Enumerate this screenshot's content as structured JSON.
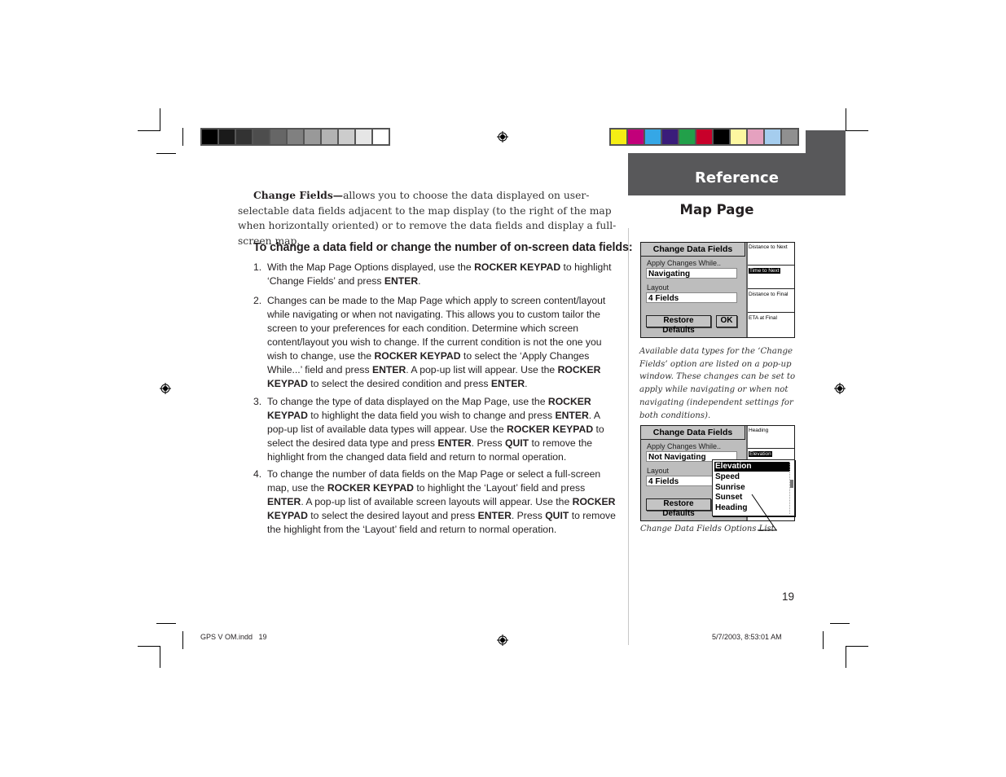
{
  "header": {
    "section_tab": "Reference",
    "page_title": "Map Page"
  },
  "print_marks": {
    "gray_bar_colors": [
      "#000000",
      "#1a1a1a",
      "#333333",
      "#4d4d4d",
      "#666666",
      "#808080",
      "#999999",
      "#b3b3b3",
      "#cccccc",
      "#e6e6e6",
      "#ffffff"
    ],
    "color_bar_colors": [
      "#f5ee15",
      "#c2007a",
      "#35a7e6",
      "#3a1c7a",
      "#22a04a",
      "#c8002a",
      "#000000",
      "#fdf7a0",
      "#e5a1bf",
      "#a5cdee",
      "#909090"
    ],
    "accent_tab_color": "#58585a"
  },
  "intro": {
    "term": "Change Fields—",
    "text": "allows you to choose the data displayed on user-selectable data fields adjacent to the map display (to the right of the map when horizontally oriented) or to remove the data fields and display a full-screen map."
  },
  "procedure": {
    "heading": "To change a data field or change the number of on-screen data fields:",
    "steps": [
      {
        "num": "1.",
        "parts": [
          "With the Map Page Options displayed, use the ",
          {
            "b": "ROCKER KEYPAD"
          },
          " to highlight ‘Change Fields’ and press ",
          {
            "b": "ENTER"
          },
          "."
        ]
      },
      {
        "num": "2.",
        "parts": [
          "Changes can be made to the Map Page which apply to screen content/layout while navigating or when not navigating. This allows you to custom tailor the screen to your preferences for each condition. Determine which screen content/layout you wish to change. If the current condition is not the one you wish to change, use the ",
          {
            "b": "ROCKER KEYPAD"
          },
          " to select the ‘Apply Changes While...’ field and press ",
          {
            "b": "ENTER"
          },
          ".  A pop-up list will appear. Use the ",
          {
            "b": "ROCKER KEYPAD"
          },
          " to select the desired condition and press ",
          {
            "b": "ENTER"
          },
          "."
        ]
      },
      {
        "num": "3.",
        "parts": [
          "To change the type of data displayed on the Map Page, use the ",
          {
            "b": "ROCKER KEYPAD"
          },
          " to highlight the data field you wish to change and press ",
          {
            "b": "ENTER"
          },
          ". A pop-up list of available data types will appear. Use the ",
          {
            "b": "ROCKER KEYPAD"
          },
          " to select the desired data type and press ",
          {
            "b": "ENTER"
          },
          ". Press ",
          {
            "b": "QUIT"
          },
          " to remove the highlight from the changed data field and return to normal operation."
        ]
      },
      {
        "num": "4.",
        "parts": [
          "To change the number of data fields on the Map Page or select a full-screen map, use the ",
          {
            "b": "ROCKER KEYPAD"
          },
          " to highlight the ‘Layout’ field and press ",
          {
            "b": "ENTER"
          },
          ". A pop-up list of available screen layouts will appear. Use the ",
          {
            "b": "ROCKER KEYPAD"
          },
          " to select the desired layout and press ",
          {
            "b": "ENTER"
          },
          ". Press ",
          {
            "b": "QUIT"
          },
          " to remove the highlight from the ‘Layout’ field and return to normal operation."
        ]
      }
    ]
  },
  "screen1": {
    "title": "Change Data Fields",
    "apply_label": "Apply Changes While..",
    "apply_value": "Navigating",
    "layout_label": "Layout",
    "layout_value": "4 Fields",
    "restore_button": "Restore Defaults",
    "ok_button": "OK",
    "data_fields": [
      "Distance to Next",
      "Time to Next",
      "Distance to Final",
      "ETA at Final"
    ],
    "highlighted_field_index": 1
  },
  "caption1": "Available data types for the ‘Change Fields’ option are listed on a pop-up window. These changes can be set to apply while navigating or when not navigating (independent settings for both conditions).",
  "screen2": {
    "title": "Change Data Fields",
    "apply_label": "Apply Changes While..",
    "apply_value": "Not Navigating",
    "layout_label": "Layout",
    "layout_value": "4 Fields",
    "restore_button": "Restore Defaults",
    "data_fields": [
      "Heading",
      "Elevation"
    ],
    "popup_options": [
      "Elevation",
      "Speed",
      "Sunrise",
      "Sunset",
      "Heading"
    ],
    "popup_selected_index": 0
  },
  "caption2": "Change Data Fields Options List",
  "page_number": "19",
  "slug": {
    "file": "GPS V OM.indd   19",
    "timestamp": "5/7/2003, 8:53:01 AM"
  }
}
